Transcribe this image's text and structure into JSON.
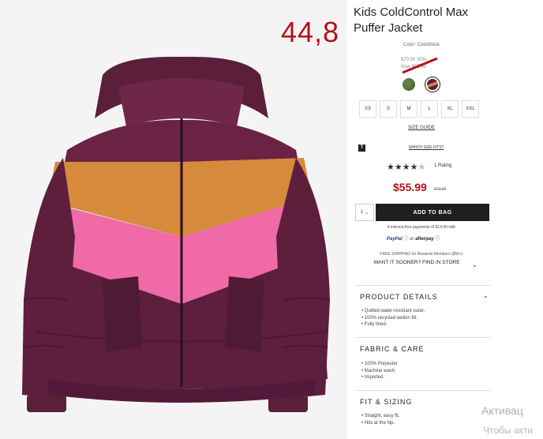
{
  "overlay_price": "44,8",
  "product": {
    "title": "Kids ColdControl Max Puffer Jacket",
    "color_label": "Color: Colorblock",
    "strike_price": "$70.00",
    "strike_pct": "30%",
    "strike_note": "Now $55.99",
    "swatches": [
      "green-swatch",
      "colorblock-swatch"
    ],
    "sizes": [
      "XS",
      "S",
      "M",
      "L",
      "XL",
      "XXL"
    ],
    "size_guide": "SIZE GUIDE",
    "t_icon": "T",
    "which_size": "WHICH SIZE FITS?",
    "stars": "★★★★",
    "stars_off": "★",
    "rating": 4,
    "rating_text": "1 Rating",
    "price": "$55.99",
    "was_price": "$70.00",
    "qty": "1",
    "add_to_bag": "ADD TO BAG",
    "installments": "4 interest-free payments of $14.00 with",
    "paypal": "PayPal",
    "or": "or",
    "afterpay": "afterpay",
    "free_shipping": "FREE SHIPPING for Rewards Members ($50+)",
    "want_it": "WANT IT SOONER? FIND IN STORE"
  },
  "sections": [
    {
      "title": "PRODUCT DETAILS",
      "items": [
        "Quilted water-resistant outer.",
        "100% recycled wellon fill.",
        "Fully lined."
      ]
    },
    {
      "title": "FABRIC & CARE",
      "items": [
        "100% Polyester",
        "Machine wash.",
        "Imported."
      ]
    },
    {
      "title": "FIT & SIZING",
      "items": [
        "Straight, easy fit.",
        "Hits at the hip."
      ]
    }
  ],
  "watermark": {
    "line1": "Активац",
    "line2": "Чтобы акти"
  },
  "colors": {
    "accent_red": "#b3121a",
    "bag_button": "#1f1f1f",
    "jacket_plum": "#5b1f3a",
    "jacket_orange": "#d68a3c",
    "jacket_pink": "#f06aa8"
  }
}
